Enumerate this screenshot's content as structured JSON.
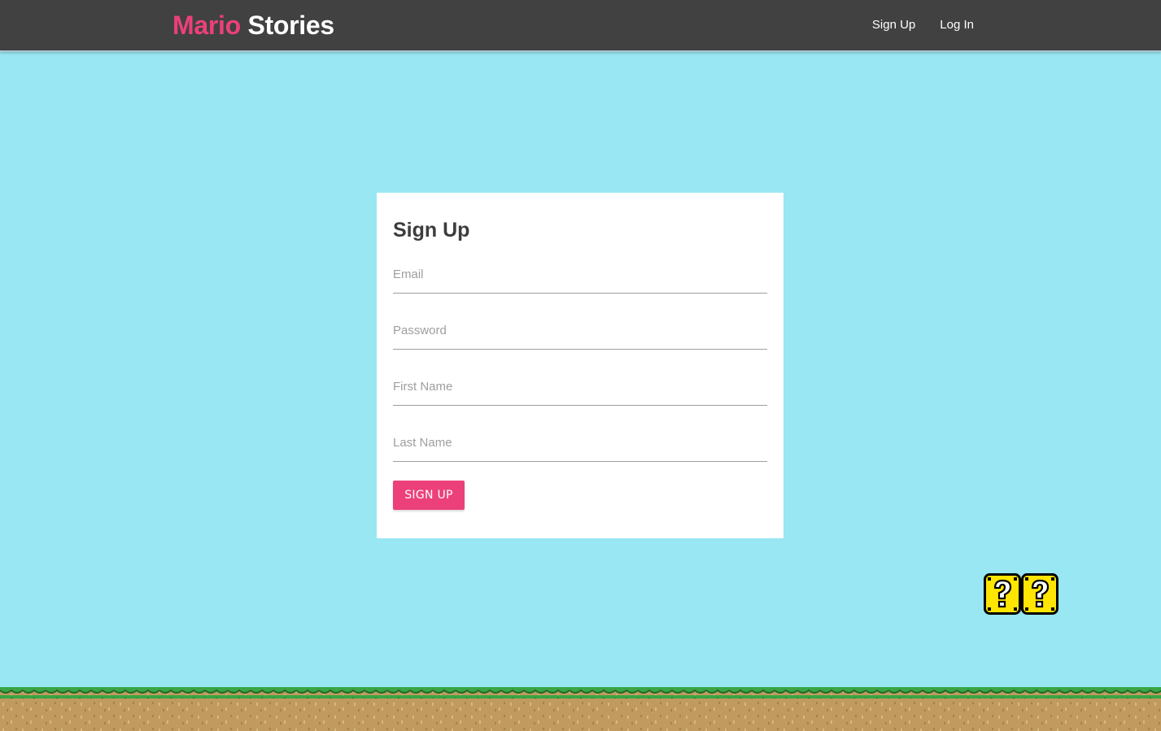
{
  "header": {
    "brand_first": "Mario",
    "brand_second": "Stories",
    "nav": [
      {
        "label": "Sign Up"
      },
      {
        "label": "Log In"
      }
    ]
  },
  "signup_form": {
    "title": "Sign Up",
    "fields": [
      {
        "name": "email",
        "placeholder": "Email",
        "value": ""
      },
      {
        "name": "password",
        "placeholder": "Password",
        "value": ""
      },
      {
        "name": "first_name",
        "placeholder": "First Name",
        "value": ""
      },
      {
        "name": "last_name",
        "placeholder": "Last Name",
        "value": ""
      }
    ],
    "submit_label": "SIGN UP"
  },
  "decor": {
    "question_blocks": 2,
    "block_icon": "question-block-icon",
    "ground_icon": "grass-ground-icon"
  },
  "colors": {
    "sky": "#98e7f2",
    "navbar": "#414141",
    "accent": "#ec407a",
    "grass": "#3aa544",
    "dirt": "#c09a5e",
    "block_yellow": "#ffe500"
  }
}
